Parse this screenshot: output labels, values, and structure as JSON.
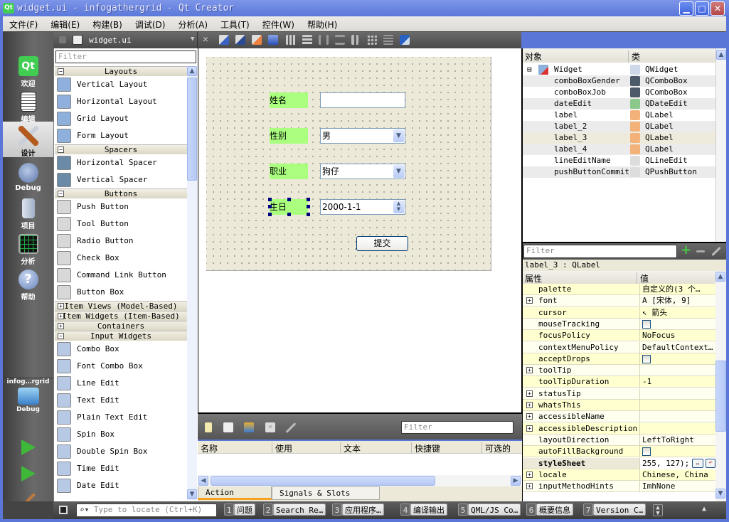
{
  "window": {
    "title": "widget.ui - infogathergrid - Qt Creator",
    "logo": "Qt",
    "controls": [
      "minimize",
      "maximize",
      "close"
    ]
  },
  "menubar": [
    "文件(F)",
    "编辑(E)",
    "构建(B)",
    "调试(D)",
    "分析(A)",
    "工具(T)",
    "控件(W)",
    "帮助(H)"
  ],
  "modebar": {
    "modes": [
      {
        "label": "欢迎",
        "icon": "qt-logo-icon"
      },
      {
        "label": "编辑",
        "icon": "edit-document-icon"
      },
      {
        "label": "设计",
        "icon": "design-brush-icon",
        "active": true
      },
      {
        "label": "Debug",
        "icon": "debug-bug-icon"
      },
      {
        "label": "项目",
        "icon": "project-folder-icon"
      },
      {
        "label": "分析",
        "icon": "analyze-monitor-icon"
      },
      {
        "label": "帮助",
        "icon": "help-icon"
      }
    ],
    "kit": {
      "project": "infog…rgrid",
      "config": "Debug"
    },
    "actions": [
      "run",
      "debug-run",
      "build"
    ]
  },
  "editor_toolbar": {
    "file": "widget.ui",
    "tools": [
      "edit-widgets",
      "edit-signals-slots",
      "edit-buddies",
      "edit-tab-order",
      "layout-horizontal",
      "layout-vertical",
      "layout-h-splitter",
      "layout-v-splitter",
      "layout-form",
      "layout-grid",
      "break-layout",
      "adjust-size"
    ]
  },
  "widget_box": {
    "filter_placeholder": "Filter",
    "categories": [
      {
        "name": "Layouts",
        "expanded": true,
        "items": [
          "Vertical Layout",
          "Horizontal Layout",
          "Grid Layout",
          "Form Layout"
        ]
      },
      {
        "name": "Spacers",
        "expanded": true,
        "items": [
          "Horizontal Spacer",
          "Vertical Spacer"
        ]
      },
      {
        "name": "Buttons",
        "expanded": true,
        "items": [
          "Push Button",
          "Tool Button",
          "Radio Button",
          "Check Box",
          "Command Link Button",
          "Button Box"
        ]
      },
      {
        "name": "Item Views (Model-Based)",
        "expanded": false,
        "items": []
      },
      {
        "name": "Item Widgets (Item-Based)",
        "expanded": false,
        "items": []
      },
      {
        "name": "Containers",
        "expanded": false,
        "items": []
      },
      {
        "name": "Input Widgets",
        "expanded": true,
        "items": [
          "Combo Box",
          "Font Combo Box",
          "Line Edit",
          "Text Edit",
          "Plain Text Edit",
          "Spin Box",
          "Double Spin Box",
          "Time Edit",
          "Date Edit"
        ]
      }
    ]
  },
  "form": {
    "labels": {
      "name": "姓名",
      "gender": "性别",
      "job": "职业",
      "birthday": "生日"
    },
    "lineEditName": "",
    "comboBoxGender": "男",
    "comboBoxJob": "狗仔",
    "dateEdit": "2000-1-1",
    "submit": "提交",
    "label_bg": "#aaff7f"
  },
  "action_editor": {
    "filter_placeholder": "Filter",
    "columns": [
      "名称",
      "使用",
      "文本",
      "快捷键",
      "可选的"
    ],
    "tabs": [
      "Action Editor",
      "Signals & Slots Editor"
    ],
    "active_tab": "Action Editor"
  },
  "object_inspector": {
    "columns": [
      "对象",
      "类"
    ],
    "rows": [
      {
        "name": "Widget",
        "class": "QWidget"
      },
      {
        "name": "comboBoxGender",
        "class": "QComboBox"
      },
      {
        "name": "comboBoxJob",
        "class": "QComboBox"
      },
      {
        "name": "dateEdit",
        "class": "QDateEdit"
      },
      {
        "name": "label",
        "class": "QLabel"
      },
      {
        "name": "label_2",
        "class": "QLabel"
      },
      {
        "name": "label_3",
        "class": "QLabel"
      },
      {
        "name": "label_4",
        "class": "QLabel"
      },
      {
        "name": "lineEditName",
        "class": "QLineEdit"
      },
      {
        "name": "pushButtonCommit",
        "class": "QPushButton"
      }
    ]
  },
  "property_editor": {
    "filter_placeholder": "Filter",
    "object_class": "label_3 : QLabel",
    "columns": [
      "属性",
      "值"
    ],
    "rows": [
      {
        "name": "palette",
        "value": "自定义的(3 个…",
        "expandable": false
      },
      {
        "name": "font",
        "value": "A  [宋体, 9]",
        "expandable": true
      },
      {
        "name": "cursor",
        "value": "箭头",
        "expandable": false
      },
      {
        "name": "mouseTracking",
        "value": "",
        "checkbox": true
      },
      {
        "name": "focusPolicy",
        "value": "NoFocus"
      },
      {
        "name": "contextMenuPolicy",
        "value": "DefaultContext…"
      },
      {
        "name": "acceptDrops",
        "value": "",
        "checkbox": true
      },
      {
        "name": "toolTip",
        "value": "",
        "expandable": true
      },
      {
        "name": "toolTipDuration",
        "value": "-1"
      },
      {
        "name": "statusTip",
        "value": "",
        "expandable": true
      },
      {
        "name": "whatsThis",
        "value": "",
        "expandable": true
      },
      {
        "name": "accessibleName",
        "value": "",
        "expandable": true
      },
      {
        "name": "accessibleDescription",
        "value": "",
        "expandable": true
      },
      {
        "name": "layoutDirection",
        "value": "LeftToRight"
      },
      {
        "name": "autoFillBackground",
        "value": "",
        "checkbox": true
      },
      {
        "name": "styleSheet",
        "value": " 255, 127);",
        "current": true
      },
      {
        "name": "locale",
        "value": "Chinese, China",
        "expandable": true
      },
      {
        "name": "inputMethodHints",
        "value": "ImhNone",
        "expandable": true
      }
    ]
  },
  "statusbar": {
    "locate_placeholder": "Type to locate (Ctrl+K)",
    "panes": [
      {
        "num": "1",
        "label": "问题"
      },
      {
        "num": "2",
        "label": "Search Re…"
      },
      {
        "num": "3",
        "label": "应用程序…"
      },
      {
        "num": "4",
        "label": "编译输出"
      },
      {
        "num": "5",
        "label": "QML/JS Co…"
      },
      {
        "num": "6",
        "label": "概要信息"
      },
      {
        "num": "7",
        "label": "Version C…"
      }
    ]
  }
}
